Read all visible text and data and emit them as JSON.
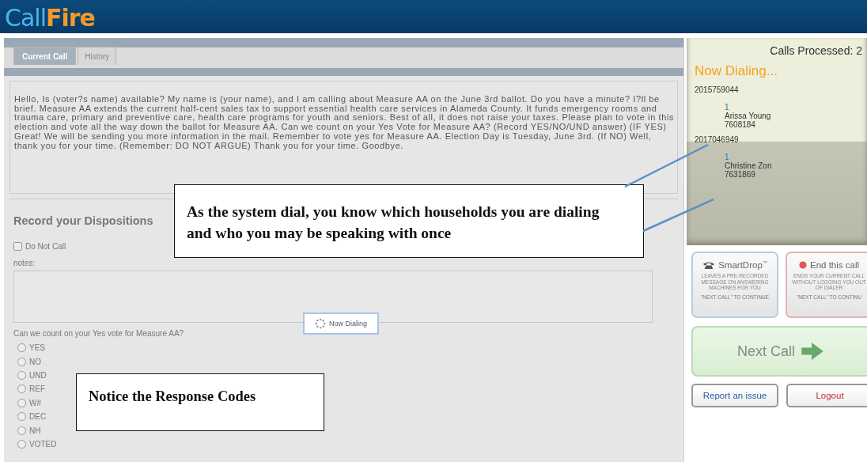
{
  "header": {
    "logo": {
      "part_1": "Call",
      "part_2": "Fire"
    }
  },
  "tabs": [
    {
      "label": "Current Call",
      "selected": true
    },
    {
      "label": "History",
      "selected": false
    }
  ],
  "script": "Hello, Is (voter?s name) available? My name is (your name), and I am calling about Measure AA on the June 3rd ballot. Do you have a minute? I?ll be brief. Measure AA extends the current half-cent sales tax to support essential health care services in Alameda County. It funds emergency rooms and trauma care, primary and preventive care, health care programs for youth and seniors. Best of all, it does not raise your taxes. Please plan to vote in this election and vote all the way down the ballot for Measure AA. Can we count on your Yes Vote for Measure AA? (Record YES/NO/UND answer) (IF YES) Great! We will be sending you more information in the mail. Remember to vote yes for Measure AA. Election Day is Tuesday, June 3rd. (If NO) Well, thank you for your time. (Remember: DO NOT ARGUE) Thank you for your time. Goodbye.",
  "dispositions": {
    "title": "Record your Dispositions",
    "do_not_call": {
      "label": "Do Not Call",
      "checked": false
    },
    "notes_label": "notes:",
    "question": "Can we count on your Yes vote for Measure AA?",
    "options": [
      {
        "label": "YES",
        "selected": false
      },
      {
        "label": "NO",
        "selected": false
      },
      {
        "label": "UND",
        "selected": false
      },
      {
        "label": "REF",
        "selected": false
      },
      {
        "label": "W#",
        "selected": false
      },
      {
        "label": "DEC",
        "selected": false
      },
      {
        "label": "NH",
        "selected": false
      },
      {
        "label": "VOTED",
        "selected": false
      }
    ]
  },
  "now_dialing_popup": "Now Dialing",
  "dialer": {
    "calls_processed": "Calls Processed: 2",
    "status": "Now Dialing...",
    "households": [
      {
        "phone": "2015759044",
        "count": "1",
        "name": "Arissa Young",
        "id": "7608184"
      },
      {
        "phone": "2017046949",
        "count": "1",
        "name": "Christine Zon",
        "id": "7631869"
      }
    ]
  },
  "smartdrop": {
    "title": "SmartDrop",
    "trademark": "™",
    "description": "LEAVES A PRE-RECORDED MESSAGE ON ANSWERING MACHINES FOR YOU",
    "hint": "\"NEXT CALL\" TO CONTINUE"
  },
  "end_call": {
    "title": "End this call",
    "description": "ENDS YOUR CURRENT CALL WITHOUT LOGGING YOU OUT OF DIALER",
    "hint": "\"NEXT CALL\" TO CONTINU"
  },
  "next_call": "Next Call",
  "report_issue": "Report an issue",
  "logout": "Logout",
  "annotations": [
    {
      "text": "As the system dial, you know which households you are dialing and who you may be speaking with once"
    },
    {
      "text": "Notice the Response Codes"
    }
  ]
}
